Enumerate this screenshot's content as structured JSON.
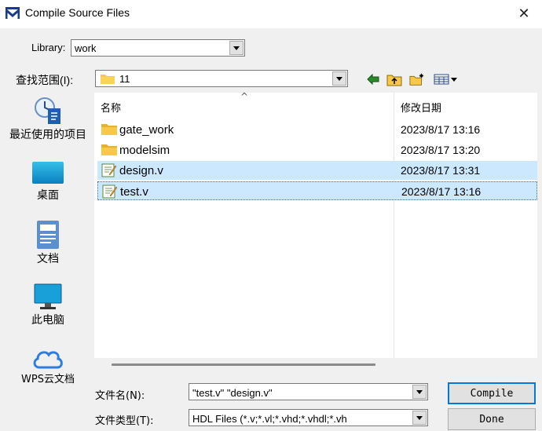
{
  "window": {
    "title": "Compile Source Files",
    "close_glyph": "✕"
  },
  "library": {
    "label": "Library:",
    "value": "work"
  },
  "lookin": {
    "label": "查找范围(I):",
    "value": "11"
  },
  "toolbar": {
    "icons": [
      "back-arrow-icon",
      "up-folder-icon",
      "new-folder-icon",
      "view-menu-icon"
    ]
  },
  "places": {
    "recent": "最近使用的项目",
    "desktop": "桌面",
    "documents": "文档",
    "computer": "此电脑",
    "wps": "WPS云文档"
  },
  "filelist": {
    "col_name": "名称",
    "col_date": "修改日期",
    "sort_glyph": "^",
    "rows": [
      {
        "name": "gate_work",
        "date": "2023/8/17 13:16",
        "type": "folder",
        "selected": false
      },
      {
        "name": "modelsim",
        "date": "2023/8/17 13:20",
        "type": "folder",
        "selected": false
      },
      {
        "name": "design.v",
        "date": "2023/8/17 13:31",
        "type": "file",
        "selected": true
      },
      {
        "name": "test.v",
        "date": "2023/8/17 13:16",
        "type": "file",
        "selected": true
      }
    ]
  },
  "filename": {
    "label": "文件名(N):",
    "value": "\"test.v\" \"design.v\""
  },
  "filetype": {
    "label": "文件类型(T):",
    "value": "HDL Files (*.v;*.vl;*.vhd;*.vhdl;*.vh"
  },
  "buttons": {
    "compile": "Compile",
    "done": "Done"
  },
  "colors": {
    "selection": "#cce8ff",
    "folder": "#f8c846",
    "accent": "#0078d7"
  }
}
